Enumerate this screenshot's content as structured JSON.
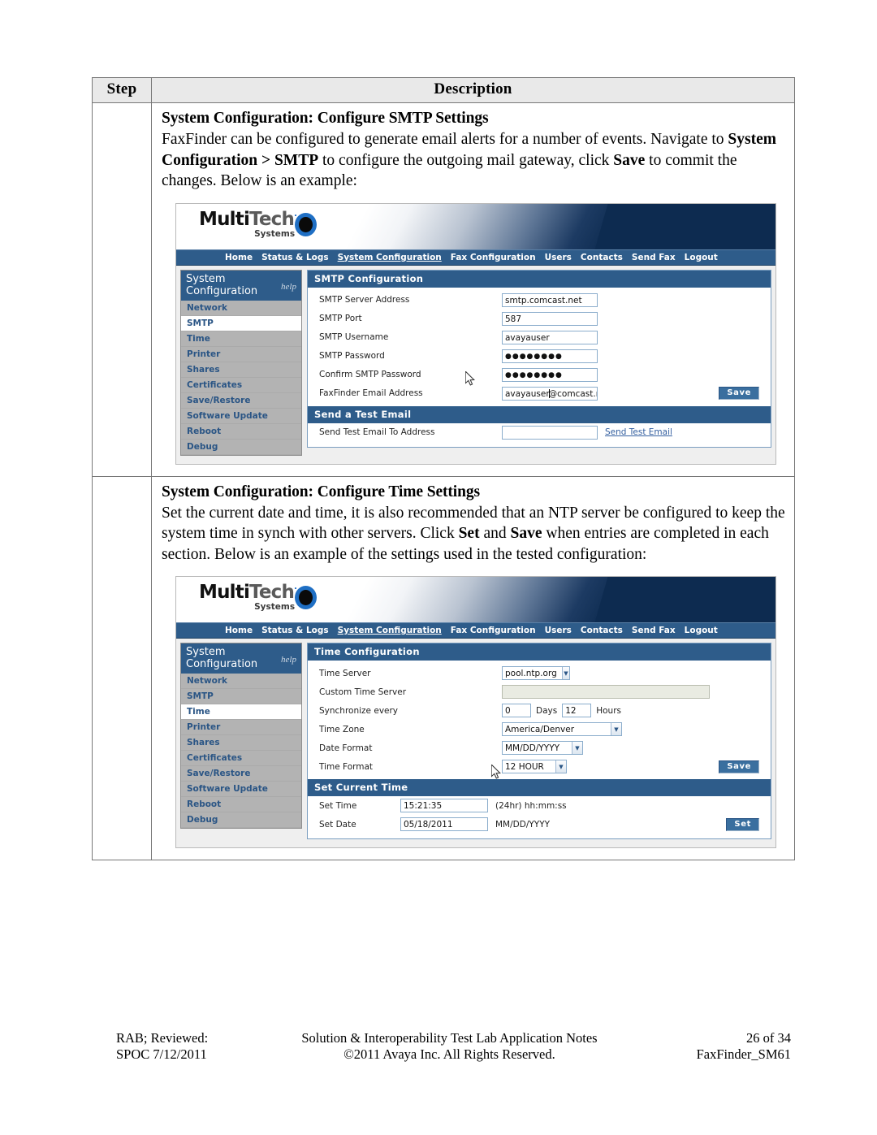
{
  "table": {
    "headers": {
      "step": "Step",
      "description": "Description"
    },
    "rows": [
      {
        "step": "",
        "title": "System Configuration: Configure SMTP Settings",
        "body_line1": "FaxFinder can be configured to generate email alerts for a number of events. Navigate to",
        "body_bold1": "System Configuration > SMTP",
        "body_line2": " to configure the outgoing mail gateway, click ",
        "body_bold2": "Save",
        "body_line3": " to",
        "body_line4": "commit the changes. Below is an example:"
      },
      {
        "step": "",
        "title": "System Configuration: Configure Time Settings",
        "body_line1": "Set the current date and time, it is also recommended that an NTP server be configured",
        "body_line2": "to keep the system time in synch with other servers. Click ",
        "body_bold1": "Set",
        "body_line3": " and ",
        "body_bold2": "Save",
        "body_line4": " when entries are",
        "body_line5": "completed in each section. Below is an example of the settings used in the tested",
        "body_line6": "configuration:"
      }
    ]
  },
  "app": {
    "logo": {
      "multi": "Multi",
      "tech": "Tech",
      "tm": "·",
      "systems": "Systems"
    },
    "nav": [
      {
        "label": "Home",
        "active": false
      },
      {
        "label": "Status & Logs",
        "active": false
      },
      {
        "label": "System Configuration",
        "active": true
      },
      {
        "label": "Fax Configuration",
        "active": false
      },
      {
        "label": "Users",
        "active": false
      },
      {
        "label": "Contacts",
        "active": false
      },
      {
        "label": "Send Fax",
        "active": false
      },
      {
        "label": "Logout",
        "active": false
      }
    ],
    "sidebar": {
      "title_line1": "System",
      "title_line2": "Configuration",
      "help": "help",
      "items": [
        "Network",
        "SMTP",
        "Time",
        "Printer",
        "Shares",
        "Certificates",
        "Save/Restore",
        "Software Update",
        "Reboot",
        "Debug"
      ]
    }
  },
  "smtp_screen": {
    "panel_title": "SMTP Configuration",
    "fields": [
      {
        "label": "SMTP Server Address",
        "value": "smtp.comcast.net"
      },
      {
        "label": "SMTP Port",
        "value": "587"
      },
      {
        "label": "SMTP Username",
        "value": "avayauser"
      },
      {
        "label": "SMTP Password",
        "value": "●●●●●●●●"
      },
      {
        "label": "Confirm SMTP Password",
        "value": "●●●●●●●●"
      },
      {
        "label": "FaxFinder Email Address",
        "value_a": "avayauser",
        "value_b": "@comcast.n"
      }
    ],
    "save_label": "Save",
    "test_section_title": "Send a Test Email",
    "test_label": "Send Test Email To Address",
    "test_value": "",
    "test_link": "Send Test Email",
    "selected_sidebar_item": "SMTP"
  },
  "time_screen": {
    "panel_title": "Time Configuration",
    "time_server_label": "Time Server",
    "time_server_value": "pool.ntp.org",
    "custom_label": "Custom Time Server",
    "custom_value": "",
    "sync_label": "Synchronize every",
    "sync_days": "0",
    "days_unit": "Days",
    "sync_hours": "12",
    "hours_unit": "Hours",
    "tz_label": "Time Zone",
    "tz_value": "America/Denver",
    "date_fmt_label": "Date Format",
    "date_fmt_value": "MM/DD/YYYY",
    "time_fmt_label": "Time Format",
    "time_fmt_value": "12 HOUR",
    "save_label": "Save",
    "set_section_title": "Set Current Time",
    "set_time_label": "Set Time",
    "set_time_value": "15:21:35",
    "set_time_hint": "(24hr) hh:mm:ss",
    "set_date_label": "Set Date",
    "set_date_value": "05/18/2011",
    "set_date_hint": "MM/DD/YYYY",
    "set_label": "Set",
    "selected_sidebar_item": "Time"
  },
  "footer": {
    "left_line1": "RAB; Reviewed:",
    "left_line2": "SPOC 7/12/2011",
    "center_line1": "Solution & Interoperability Test Lab Application Notes",
    "center_line2": "©2011 Avaya Inc. All Rights Reserved.",
    "right_line1": "26 of 34",
    "right_line2": "FaxFinder_SM61"
  }
}
